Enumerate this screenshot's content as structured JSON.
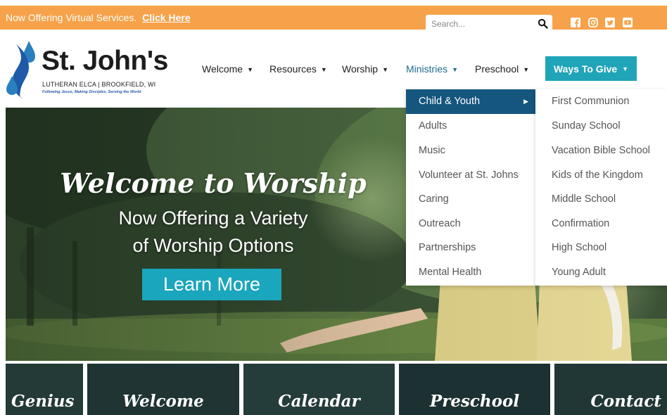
{
  "topbar": {
    "message": "Now Offering Virtual Services.",
    "link": "Click Here"
  },
  "search": {
    "placeholder": "Search...",
    "icon": "search-icon"
  },
  "social": [
    "facebook-icon",
    "instagram-icon",
    "twitter-icon",
    "youtube-icon"
  ],
  "logo": {
    "title": "St. John's",
    "subtitle": "LUTHERAN ELCA | BROOKFIELD, WI",
    "tagline": "Following Jesus, Making Disciples, Serving the World"
  },
  "nav": {
    "items": [
      "Welcome",
      "Resources",
      "Worship",
      "Ministries",
      "Preschool"
    ],
    "give": "Ways To Give"
  },
  "ministries_menu": [
    "Child & Youth",
    "Adults",
    "Music",
    "Volunteer at St. Johns",
    "Caring",
    "Outreach",
    "Partnerships",
    "Mental Health"
  ],
  "child_youth_menu": [
    "First Communion",
    "Sunday School",
    "Vacation Bible School",
    "Kids of the Kingdom",
    "Middle School",
    "Confirmation",
    "High School",
    "Young Adult"
  ],
  "hero": {
    "title": "Welcome to Worship",
    "line1": "Now Offering a Variety",
    "line2": "of Worship Options",
    "button": "Learn More"
  },
  "tiles": [
    "Genius",
    "Welcome",
    "Calendar",
    "Preschool",
    "Contact"
  ],
  "colors": {
    "topbar": "#f6a24a",
    "accent": "#20a4b8",
    "menu_highlight": "#15567e",
    "logo_blue": "#1e5aa8"
  }
}
